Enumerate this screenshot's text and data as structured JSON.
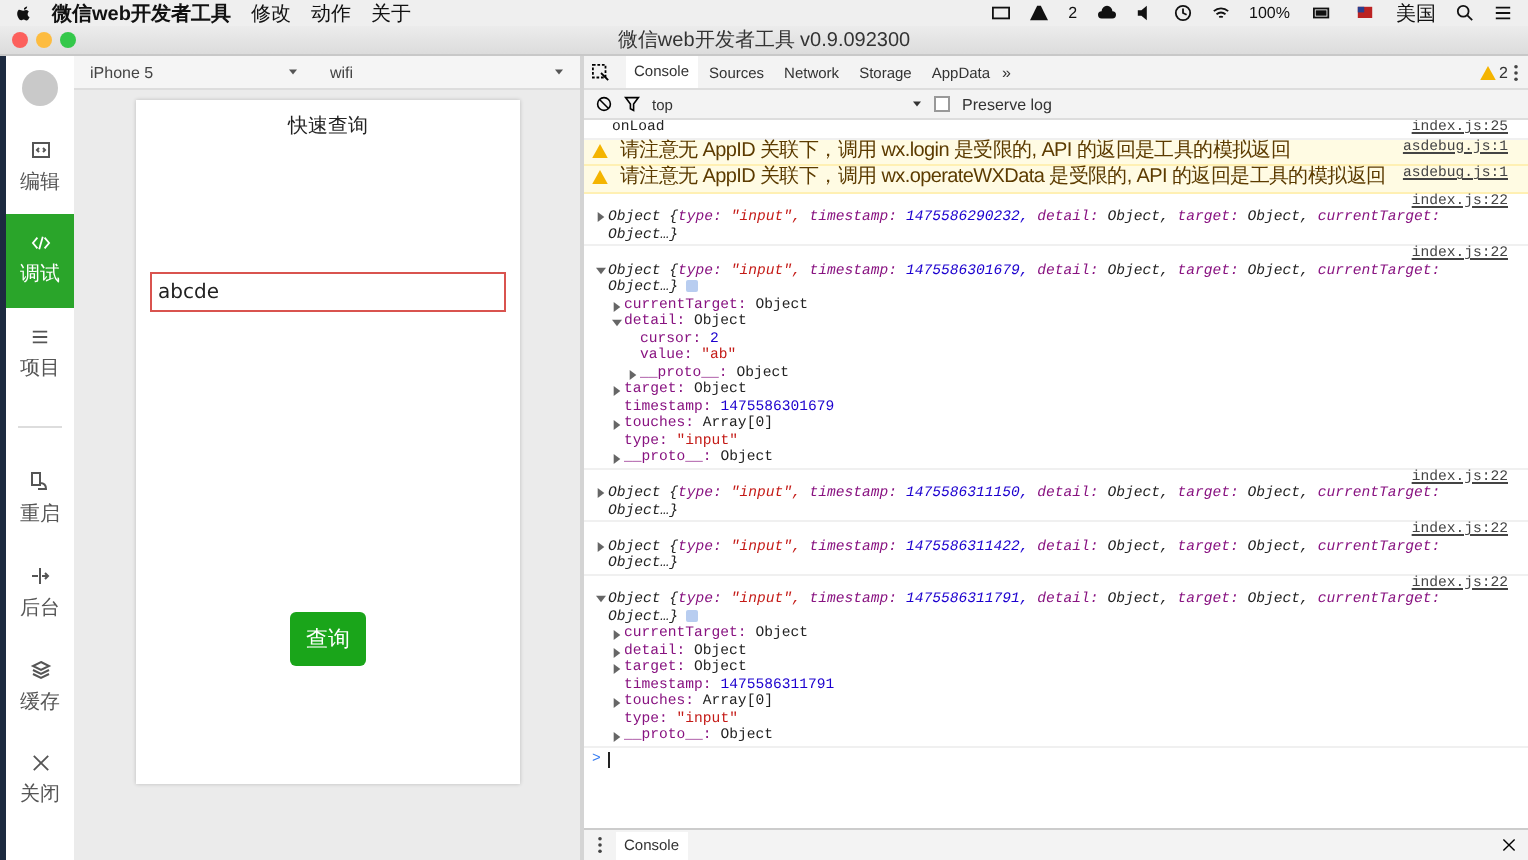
{
  "menu_bar": {
    "app_name": "微信web开发者工具",
    "menus": [
      "修改",
      "动作",
      "关于"
    ],
    "badge_count": "2",
    "battery": "100%",
    "input_source": "美国"
  },
  "window": {
    "title": "微信web开发者工具 v0.9.092300"
  },
  "sidebar": {
    "items": [
      {
        "label": "编辑",
        "kind": "editor",
        "selected": false
      },
      {
        "label": "调试",
        "kind": "code",
        "selected": true
      },
      {
        "label": "项目",
        "kind": "list",
        "selected": false
      }
    ],
    "tools": [
      {
        "label": "重启",
        "kind": "touch",
        "selected": false
      },
      {
        "label": "后台",
        "kind": "split",
        "selected": false
      },
      {
        "label": "缓存",
        "kind": "layers",
        "selected": false
      },
      {
        "label": "关闭",
        "kind": "close",
        "selected": false
      }
    ]
  },
  "simulator": {
    "device": "iPhone 5",
    "network": "wifi",
    "page": {
      "title": "快速查询",
      "input": {
        "value": "abcde",
        "focused": true
      },
      "button": "查询"
    }
  },
  "devtools": {
    "tabs": [
      {
        "label": "Console",
        "selected": true
      },
      {
        "label": "Sources",
        "selected": false
      },
      {
        "label": "Network",
        "selected": false
      },
      {
        "label": "Storage",
        "selected": false
      },
      {
        "label": "AppData",
        "selected": false
      }
    ],
    "more": "»",
    "warnings": "2",
    "filter": {
      "context": "top",
      "preserve_log": {
        "label": "Preserve log",
        "checked": false
      }
    },
    "console": {
      "entries": [
        {
          "kind": "log",
          "text": "onLoad",
          "source": "index.js:25"
        },
        {
          "kind": "warning",
          "text": "请注意无 AppID 关联下，调用 wx.login 是受限的, API 的返回是工具的模拟返回",
          "source": "asdebug.js:1"
        },
        {
          "kind": "warning",
          "text": "请注意无 AppID 关联下，调用 wx.operateWXData 是受限的, API 的返回是工具的模拟返回",
          "source": "asdebug.js:1"
        },
        {
          "kind": "object",
          "source": "index.js:22",
          "expanded": false,
          "summary": {
            "label": "Object {",
            "fields": [
              {
                "key": "type:",
                "value": "\"input\",",
                "kind": "string"
              },
              {
                "key": "timestamp:",
                "value": "1475586290232,",
                "kind": "number"
              },
              {
                "key": "detail:",
                "value": "Object,",
                "kind": "object"
              },
              {
                "key": "target:",
                "value": "Object,",
                "kind": "object"
              },
              {
                "key": "currentTarget:",
                "value": "Object…}",
                "kind": "object"
              }
            ]
          }
        },
        {
          "kind": "object",
          "source": "index.js:22",
          "expanded": true,
          "summary": {
            "label": "Object {",
            "fields": [
              {
                "key": "type:",
                "value": "\"input\",",
                "kind": "string"
              },
              {
                "key": "timestamp:",
                "value": "1475586301679,",
                "kind": "number"
              },
              {
                "key": "detail:",
                "value": "Object,",
                "kind": "object"
              },
              {
                "key": "target:",
                "value": "Object,",
                "kind": "object"
              },
              {
                "key": "currentTarget:",
                "value": "Object…}",
                "kind": "object"
              }
            ]
          },
          "properties": [
            {
              "key": "currentTarget:",
              "value": "Object",
              "kind": "object",
              "expanded": false
            },
            {
              "key": "detail:",
              "value": "Object",
              "kind": "object",
              "expanded": true,
              "children": [
                {
                  "key": "cursor:",
                  "value": "2",
                  "kind": "number"
                },
                {
                  "key": "value:",
                  "value": "\"ab\"",
                  "kind": "string"
                },
                {
                  "key": "__proto__:",
                  "value": "Object",
                  "kind": "object",
                  "expanded": false
                }
              ]
            },
            {
              "key": "target:",
              "value": "Object",
              "kind": "object",
              "expanded": false
            },
            {
              "key": "timestamp:",
              "value": "1475586301679",
              "kind": "number"
            },
            {
              "key": "touches:",
              "value": "Array[0]",
              "kind": "object",
              "expanded": false
            },
            {
              "key": "type:",
              "value": "\"input\"",
              "kind": "string"
            },
            {
              "key": "__proto__:",
              "value": "Object",
              "kind": "object",
              "expanded": false
            }
          ]
        },
        {
          "kind": "object",
          "source": "index.js:22",
          "expanded": false,
          "summary": {
            "label": "Object {",
            "fields": [
              {
                "key": "type:",
                "value": "\"input\",",
                "kind": "string"
              },
              {
                "key": "timestamp:",
                "value": "1475586311150,",
                "kind": "number"
              },
              {
                "key": "detail:",
                "value": "Object,",
                "kind": "object"
              },
              {
                "key": "target:",
                "value": "Object,",
                "kind": "object"
              },
              {
                "key": "currentTarget:",
                "value": "Object…}",
                "kind": "object"
              }
            ]
          }
        },
        {
          "kind": "object",
          "source": "index.js:22",
          "expanded": false,
          "summary": {
            "label": "Object {",
            "fields": [
              {
                "key": "type:",
                "value": "\"input\",",
                "kind": "string"
              },
              {
                "key": "timestamp:",
                "value": "1475586311422,",
                "kind": "number"
              },
              {
                "key": "detail:",
                "value": "Object,",
                "kind": "object"
              },
              {
                "key": "target:",
                "value": "Object,",
                "kind": "object"
              },
              {
                "key": "currentTarget:",
                "value": "Object…}",
                "kind": "object"
              }
            ]
          }
        },
        {
          "kind": "object",
          "source": "index.js:22",
          "expanded": true,
          "summary": {
            "label": "Object {",
            "fields": [
              {
                "key": "type:",
                "value": "\"input\",",
                "kind": "string"
              },
              {
                "key": "timestamp:",
                "value": "1475586311791,",
                "kind": "number"
              },
              {
                "key": "detail:",
                "value": "Object,",
                "kind": "object"
              },
              {
                "key": "target:",
                "value": "Object,",
                "kind": "object"
              },
              {
                "key": "currentTarget:",
                "value": "Object…}",
                "kind": "object"
              }
            ]
          },
          "properties": [
            {
              "key": "currentTarget:",
              "value": "Object",
              "kind": "object",
              "expanded": false
            },
            {
              "key": "detail:",
              "value": "Object",
              "kind": "object",
              "expanded": false
            },
            {
              "key": "target:",
              "value": "Object",
              "kind": "object",
              "expanded": false
            },
            {
              "key": "timestamp:",
              "value": "1475586311791",
              "kind": "number"
            },
            {
              "key": "touches:",
              "value": "Array[0]",
              "kind": "object",
              "expanded": false
            },
            {
              "key": "type:",
              "value": "\"input\"",
              "kind": "string"
            },
            {
              "key": "__proto__:",
              "value": "Object",
              "kind": "object",
              "expanded": false
            }
          ]
        }
      ],
      "prompt": ">"
    },
    "drawer": {
      "tabs": [
        {
          "label": "Console",
          "selected": true
        }
      ]
    }
  }
}
